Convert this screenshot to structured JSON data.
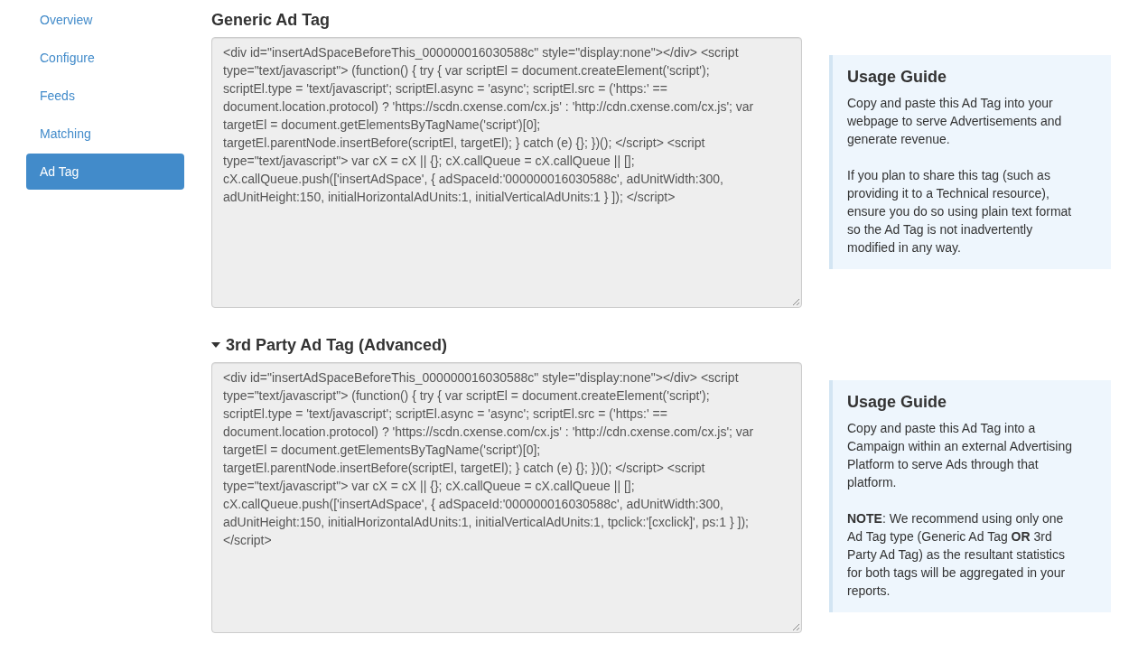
{
  "sidebar": {
    "items": [
      {
        "label": "Overview",
        "selected": false
      },
      {
        "label": "Configure",
        "selected": false
      },
      {
        "label": "Feeds",
        "selected": false
      },
      {
        "label": "Matching",
        "selected": false
      },
      {
        "label": "Ad Tag",
        "selected": true
      }
    ]
  },
  "sections": [
    {
      "title": "Generic Ad Tag",
      "code": "<div id=\"insertAdSpaceBeforeThis_000000016030588c\" style=\"display:none\"></div> <script type=\"text/javascript\"> (function() { try { var scriptEl = document.createElement('script'); scriptEl.type = 'text/javascript'; scriptEl.async = 'async'; scriptEl.src = ('https:' == document.location.protocol) ? 'https://scdn.cxense.com/cx.js' : 'http://cdn.cxense.com/cx.js'; var targetEl = document.getElementsByTagName('script')[0]; targetEl.parentNode.insertBefore(scriptEl, targetEl); } catch (e) {}; })(); </script> <script type=\"text/javascript\"> var cX = cX || {}; cX.callQueue = cX.callQueue || []; cX.callQueue.push(['insertAdSpace', { adSpaceId:'000000016030588c', adUnitWidth:300, adUnitHeight:150, initialHorizontalAdUnits:1, initialVerticalAdUnits:1 } ]); </script>",
      "guide": {
        "title": "Usage Guide",
        "paragraphs": [
          "Copy and paste this Ad Tag into your webpage to serve Advertisements and generate revenue.",
          "If you plan to share this tag (such as providing it to a Technical resource), ensure you do so using plain text format so the Ad Tag is not inadvertently modified in any way."
        ]
      }
    },
    {
      "title": "3rd Party Ad Tag (Advanced)",
      "expanded": true,
      "code": "<div id=\"insertAdSpaceBeforeThis_000000016030588c\" style=\"display:none\"></div> <script type=\"text/javascript\"> (function() { try { var scriptEl = document.createElement('script'); scriptEl.type = 'text/javascript'; scriptEl.async = 'async'; scriptEl.src = ('https:' == document.location.protocol) ? 'https://scdn.cxense.com/cx.js' : 'http://cdn.cxense.com/cx.js'; var targetEl = document.getElementsByTagName('script')[0]; targetEl.parentNode.insertBefore(scriptEl, targetEl); } catch (e) {}; })(); </script> <script type=\"text/javascript\"> var cX = cX || {}; cX.callQueue = cX.callQueue || []; cX.callQueue.push(['insertAdSpace', { adSpaceId:'000000016030588c', adUnitWidth:300, adUnitHeight:150, initialHorizontalAdUnits:1, initialVerticalAdUnits:1, tpclick:'[cxclick]', ps:1 } ]); </script>",
      "guide": {
        "title": "Usage Guide",
        "paragraphs": [
          "Copy and paste this Ad Tag into a Campaign within an external Advertising Platform to serve Ads through that platform.",
          "**NOTE**: We recommend using only one Ad Tag type (Generic Ad Tag **OR** 3rd Party Ad Tag) as the resultant statistics for both tags will be aggregated in your reports."
        ]
      }
    }
  ]
}
